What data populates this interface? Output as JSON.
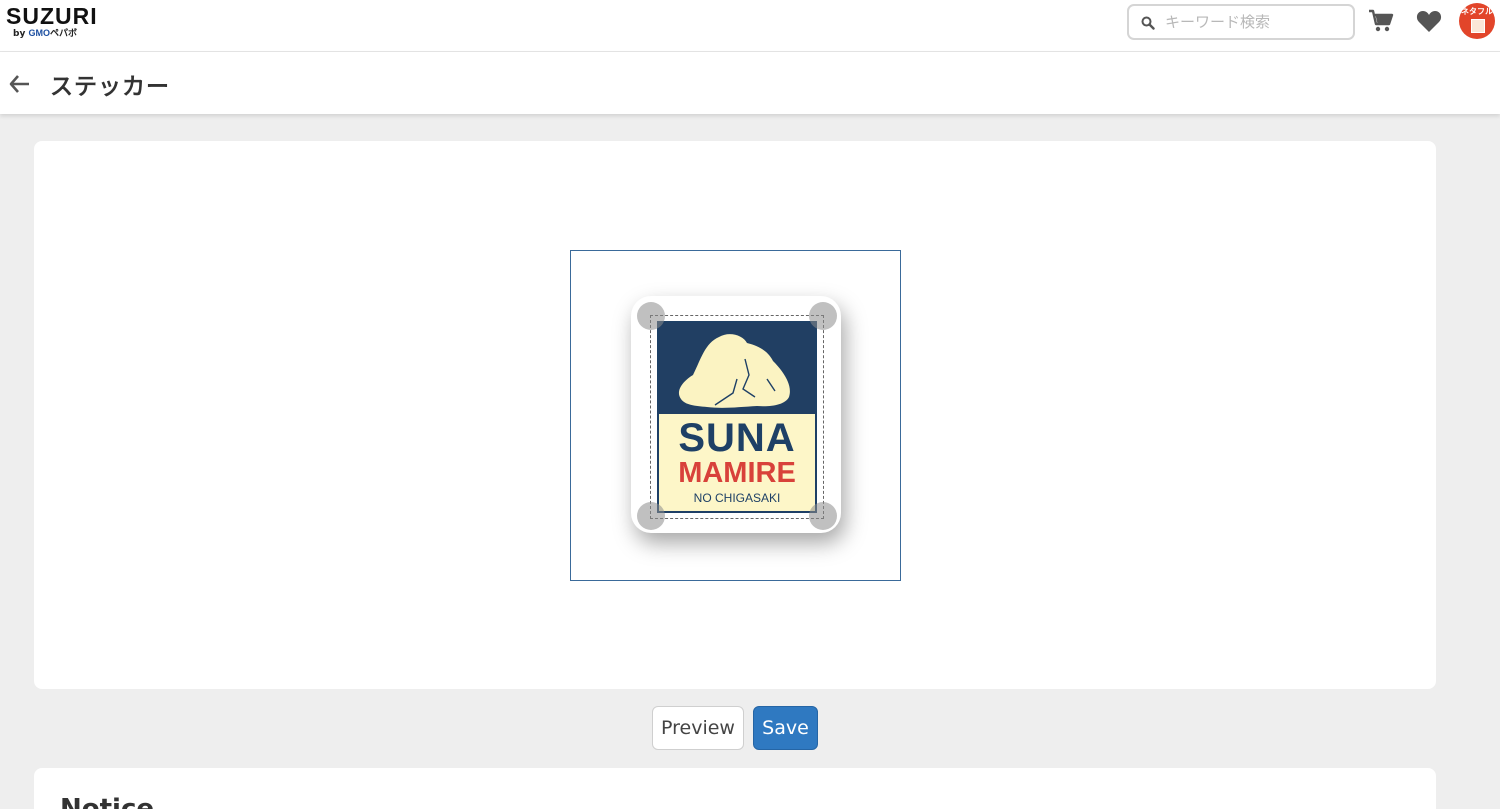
{
  "brand": {
    "name": "SUZURI",
    "sub_by": "by",
    "sub_gmo": "GMO",
    "sub_rest": "ペパボ"
  },
  "search": {
    "placeholder": "キーワード検索"
  },
  "header": {
    "title": "ステッカー"
  },
  "avatar": {
    "text": "ネタフル"
  },
  "sticker": {
    "line1": "SUNA",
    "line2": "MAMIRE",
    "line3": "NO CHIGASAKI"
  },
  "actions": {
    "preview_label": "Preview",
    "save_label": "Save"
  },
  "notice": {
    "title": "Notice"
  },
  "colors": {
    "accent": "#2f79c1",
    "sticker_navy": "#1e4066",
    "sticker_red": "#d8413a",
    "sticker_cream": "#fdf6c8"
  }
}
